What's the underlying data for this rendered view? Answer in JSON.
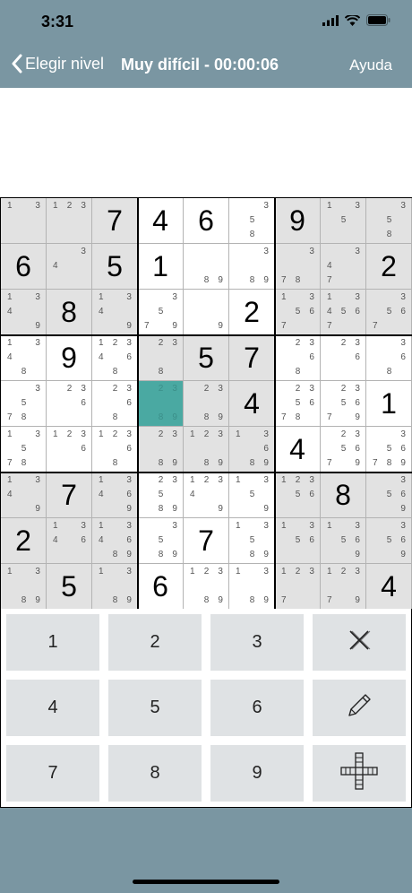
{
  "status": {
    "time": "3:31",
    "icons": [
      "signal-icon",
      "wifi-icon",
      "battery-icon"
    ]
  },
  "nav": {
    "back_label": "Elegir nivel",
    "title": "Muy difícil - 00:00:06",
    "help_label": "Ayuda"
  },
  "board": {
    "selected": [
      4,
      3
    ],
    "shaded": [
      [
        1,
        1,
        1,
        0,
        0,
        0,
        1,
        1,
        1
      ],
      [
        1,
        1,
        1,
        0,
        0,
        0,
        1,
        1,
        1
      ],
      [
        1,
        1,
        1,
        0,
        0,
        0,
        1,
        1,
        1
      ],
      [
        0,
        0,
        0,
        1,
        1,
        1,
        0,
        0,
        0
      ],
      [
        0,
        0,
        0,
        1,
        1,
        1,
        0,
        0,
        0
      ],
      [
        0,
        0,
        0,
        1,
        1,
        1,
        0,
        0,
        0
      ],
      [
        1,
        1,
        1,
        0,
        0,
        0,
        1,
        1,
        1
      ],
      [
        1,
        1,
        1,
        0,
        0,
        0,
        1,
        1,
        1
      ],
      [
        1,
        1,
        1,
        0,
        0,
        0,
        1,
        1,
        1
      ]
    ],
    "values": [
      [
        "",
        "",
        "7",
        "4",
        "6",
        "",
        "9",
        "",
        ""
      ],
      [
        "6",
        "",
        "5",
        "1",
        "",
        "",
        "",
        "",
        "2"
      ],
      [
        "",
        "8",
        "",
        "",
        "",
        "2",
        "",
        "",
        ""
      ],
      [
        "",
        "9",
        "",
        "",
        "5",
        "7",
        "",
        "",
        ""
      ],
      [
        "",
        "",
        "",
        "",
        "",
        "4",
        "",
        "",
        "1"
      ],
      [
        "",
        "",
        "",
        "",
        "",
        "",
        "4",
        "",
        ""
      ],
      [
        "",
        "7",
        "",
        "",
        "",
        "",
        "",
        "8",
        ""
      ],
      [
        "2",
        "",
        "",
        "",
        "7",
        "",
        "",
        "",
        ""
      ],
      [
        "",
        "5",
        "",
        "6",
        "",
        "",
        "",
        "",
        "4"
      ]
    ],
    "candidates": [
      [
        "13",
        "123",
        "",
        "",
        "",
        "358",
        "",
        "135",
        "358"
      ],
      [
        "",
        "43",
        "",
        "",
        "89",
        "389",
        "378",
        "347",
        ""
      ],
      [
        "1349",
        "",
        "1349",
        "3579",
        "9",
        "",
        "13567",
        "134567",
        "3567"
      ],
      [
        "1348",
        "",
        "123468",
        "238",
        "",
        "",
        "2368",
        "236",
        "368"
      ],
      [
        "3578",
        "236",
        "2368",
        "2389",
        "2389",
        "",
        "235678",
        "235679",
        ""
      ],
      [
        "13578",
        "1236",
        "12368",
        "2389",
        "12389",
        "13689",
        "",
        "235679",
        "356789"
      ],
      [
        "1349",
        "",
        "13469",
        "23589",
        "12349",
        "1359",
        "12356",
        "",
        "3569"
      ],
      [
        "",
        "1346",
        "134689",
        "3589",
        "",
        "13589",
        "1356",
        "13569",
        "3569"
      ],
      [
        "1389",
        "",
        "1389",
        "",
        "12389",
        "1389",
        "1237",
        "12379",
        ""
      ]
    ]
  },
  "keypad": {
    "keys": [
      "1",
      "2",
      "3",
      "clear-icon",
      "4",
      "5",
      "6",
      "pencil-icon",
      "7",
      "8",
      "9",
      "crosshair-icon"
    ]
  }
}
